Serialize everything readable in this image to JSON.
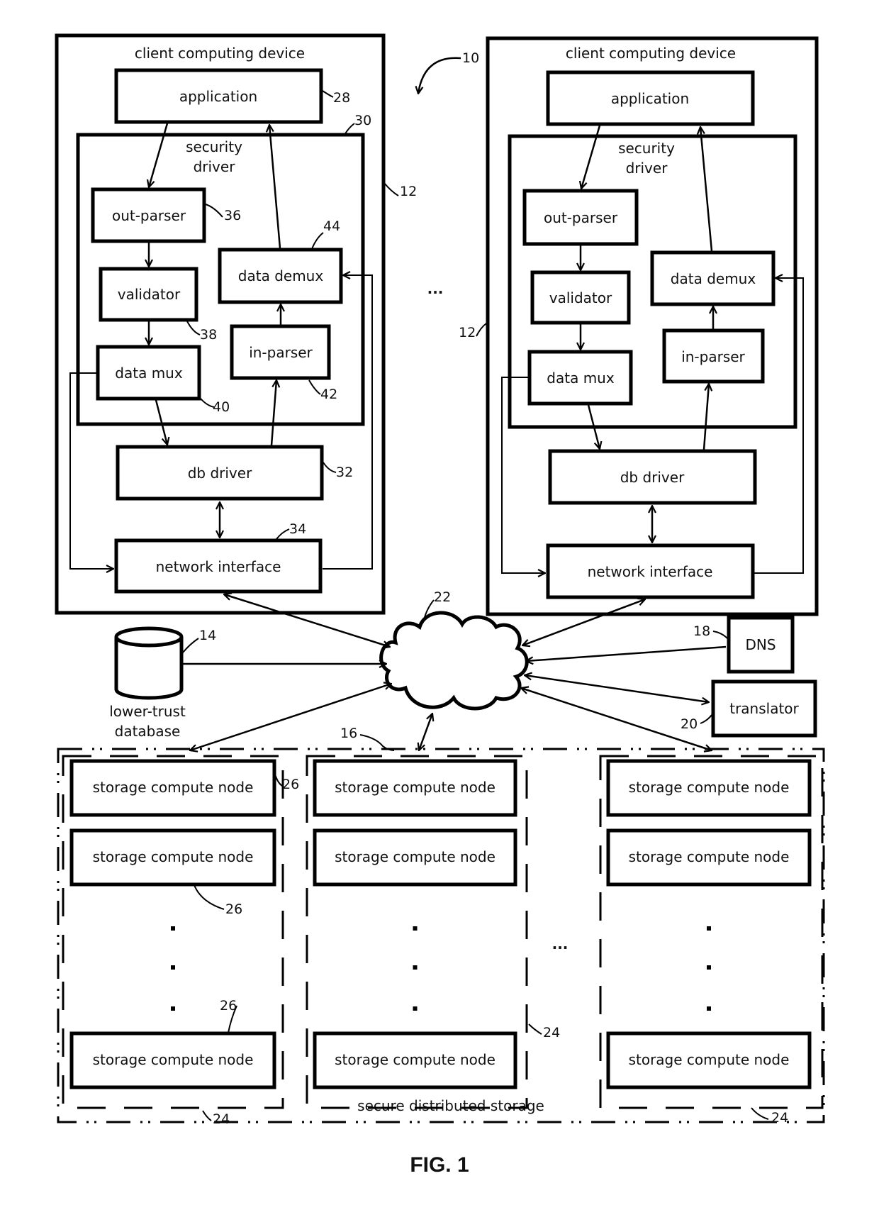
{
  "figure": {
    "caption": "FIG. 1",
    "system_ref": "10"
  },
  "client_devices": [
    {
      "title": "client computing device",
      "ref": "12",
      "application": {
        "label": "application",
        "ref": "28"
      },
      "security_driver": {
        "label_line1": "security",
        "label_line2": "driver",
        "ref": "30"
      },
      "out_parser": {
        "label": "out-parser",
        "ref": "36"
      },
      "validator": {
        "label": "validator",
        "ref": "38"
      },
      "data_mux": {
        "label": "data mux",
        "ref": "40"
      },
      "data_demux": {
        "label": "data demux",
        "ref": "44"
      },
      "in_parser": {
        "label": "in-parser",
        "ref": "42"
      },
      "db_driver": {
        "label": "db driver",
        "ref": "32"
      },
      "network_interface": {
        "label": "network interface",
        "ref": "34"
      }
    },
    {
      "title": "client computing device",
      "ref": "12",
      "application": {
        "label": "application"
      },
      "security_driver": {
        "label_line1": "security",
        "label_line2": "driver"
      },
      "out_parser": {
        "label": "out-parser"
      },
      "validator": {
        "label": "validator"
      },
      "data_mux": {
        "label": "data mux"
      },
      "data_demux": {
        "label": "data demux"
      },
      "in_parser": {
        "label": "in-parser"
      },
      "db_driver": {
        "label": "db driver"
      },
      "network_interface": {
        "label": "network interface"
      }
    }
  ],
  "ellipsis": "...",
  "network": {
    "ref": "22"
  },
  "lower_trust_db": {
    "label_line1": "lower-trust",
    "label_line2": "database",
    "ref": "14"
  },
  "dns": {
    "label": "DNS",
    "ref": "18"
  },
  "translator": {
    "label": "translator",
    "ref": "20"
  },
  "secure_storage": {
    "label": "secure distributed storage",
    "ref": "16",
    "group_ref": "24",
    "node_ref": "26",
    "node_label": "storage compute node",
    "columns": [
      {
        "nodes": [
          "storage compute node",
          "storage compute node",
          "storage compute node"
        ]
      },
      {
        "nodes": [
          "storage compute node",
          "storage compute node",
          "storage compute node"
        ]
      },
      {
        "nodes": [
          "storage compute node",
          "storage compute node",
          "storage compute node"
        ]
      }
    ]
  }
}
